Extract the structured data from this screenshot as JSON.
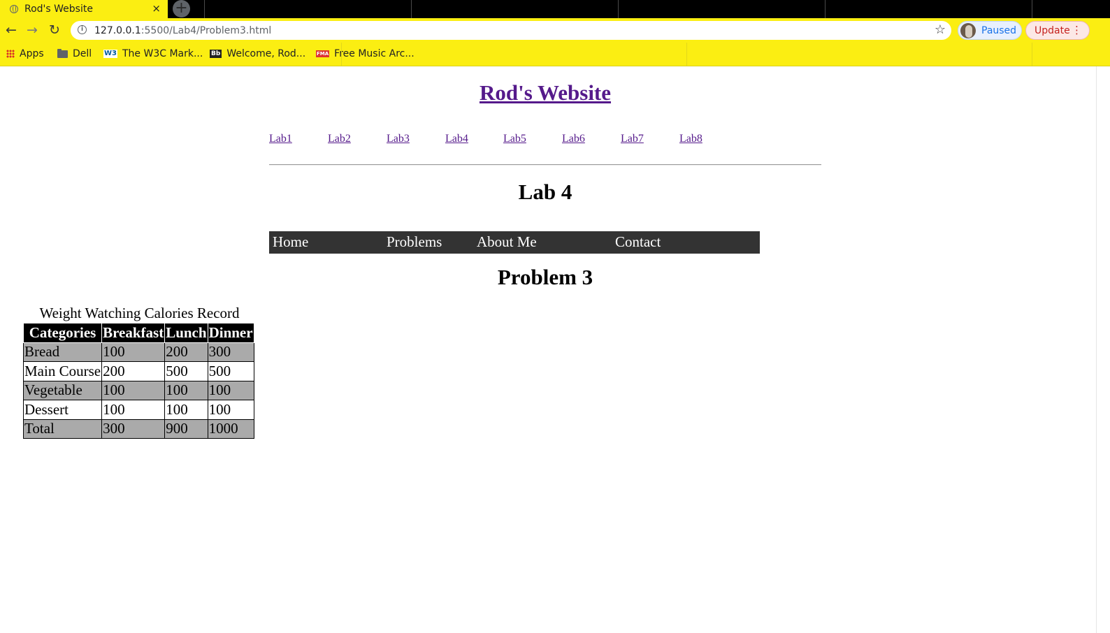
{
  "browser": {
    "tab_title": "Rod's Website",
    "tab_close": "×",
    "new_tab": "+",
    "url_host": "127.0.0.1",
    "url_path": ":5500/Lab4/Problem3.html",
    "profile_label": "Paused",
    "update_label": "Update",
    "nav": {
      "back": "←",
      "forward": "→",
      "reload": "↻",
      "star": "☆",
      "menu": "⋮",
      "info": "i"
    },
    "bookmarks": [
      {
        "label": "Apps",
        "icon": "apps-grid-icon"
      },
      {
        "label": "Dell",
        "icon": "folder-icon"
      },
      {
        "label": "The W3C Mark...",
        "icon": "w3c-icon"
      },
      {
        "label": "Welcome, Rod...",
        "icon": "blackboard-icon"
      },
      {
        "label": "Free Music Arc...",
        "icon": "fma-icon"
      }
    ],
    "icon_text": {
      "w3c": "W3",
      "bb": "Bb",
      "fma": "FMA"
    }
  },
  "page": {
    "site_title": "Rod's Website",
    "lab_links": [
      "Lab1",
      "Lab2",
      "Lab3",
      "Lab4",
      "Lab5",
      "Lab6",
      "Lab7",
      "Lab8"
    ],
    "lab_heading": "Lab 4",
    "nav_items": [
      "Home",
      "Problems",
      "About Me",
      "Contact"
    ],
    "problem_heading": "Problem 3",
    "table": {
      "caption": "Weight Watching Calories Record",
      "headers": [
        "Categories",
        "Breakfast",
        "Lunch",
        "Dinner"
      ],
      "rows": [
        [
          "Bread",
          "100",
          "200",
          "300"
        ],
        [
          "Main Course",
          "200",
          "500",
          "500"
        ],
        [
          "Vegetable",
          "100",
          "100",
          "100"
        ],
        [
          "Dessert",
          "100",
          "100",
          "100"
        ],
        [
          "Total",
          "300",
          "900",
          "1000"
        ]
      ]
    }
  },
  "colors": {
    "chrome_yellow": "#fbee12",
    "link_visited": "#551a8b",
    "navbar_bg": "#333333",
    "row_shade": "#aaaaaa"
  }
}
